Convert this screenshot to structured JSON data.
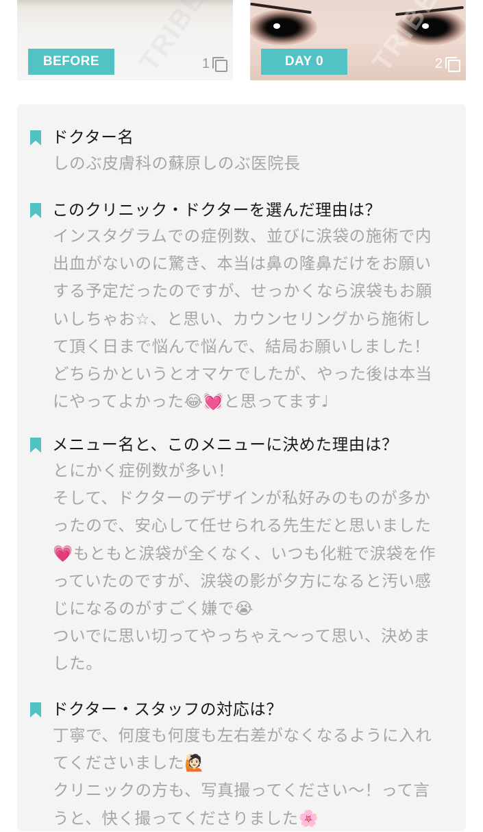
{
  "photos": [
    {
      "label": "BEFORE",
      "count": "1",
      "watermark": "TRIBE"
    },
    {
      "label": "DAY 0",
      "count": "2",
      "watermark": "TRIBE"
    }
  ],
  "icons": {
    "bookmark": "bookmark-icon",
    "stack": "multiple-photos-icon"
  },
  "colors": {
    "accent": "#52c1c3",
    "card_bg": "#f4f4f4",
    "answer_text": "#a6a6a6",
    "question_text": "#1a1a1a"
  },
  "sections": [
    {
      "question": "ドクター名",
      "answer_lines": [
        "しのぶ皮膚科の蘇原しのぶ医院長"
      ]
    },
    {
      "question": "このクリニック・ドクターを選んだ理由は？",
      "answer_lines": [
        "インスタグラムでの症例数、並びに涙袋の施術で内",
        "出血がないのに驚き、本当は鼻の隆鼻だけをお願い",
        "する予定だったのですが、せっかくなら涙袋もお願",
        "いしちゃお☆、と思い、カウンセリングから施術し",
        "て頂く日まで悩んで悩んで、結局お願いしました！",
        "どちらかというとオマケでしたが、やった後は本当",
        "にやってよかった😂💓と思ってます♩"
      ]
    },
    {
      "question": "メニュー名と、このメニューに決めた理由は？",
      "answer_lines": [
        "とにかく症例数が多い！",
        "そして、ドクターのデザインが私好みのものが多か",
        "ったので、安心して任せられる先生だと思いました",
        "💗もともと涙袋が全くなく、いつも化粧で涙袋を作",
        "っていたのですが、涙袋の影が夕方になると汚い感",
        "じになるのがすごく嫌で😭",
        "ついでに思い切ってやっちゃえ〜って思い、決めま",
        "した。"
      ]
    },
    {
      "question": "ドクター・スタッフの対応は？",
      "answer_lines": [
        "丁寧で、何度も何度も左右差がなくなるように入れ",
        "てくださいました🙋🏻",
        "クリニックの方も、写真撮ってください〜！って言",
        "うと、快く撮ってくださりました🌸"
      ]
    }
  ]
}
